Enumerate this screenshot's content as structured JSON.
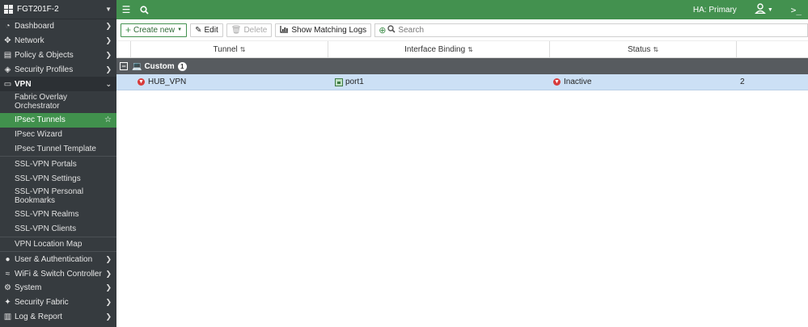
{
  "sidebar": {
    "device_name": "FGT201F-2",
    "items": [
      {
        "label": "Dashboard",
        "icon": "dashboard-icon"
      },
      {
        "label": "Network",
        "icon": "network-icon"
      },
      {
        "label": "Policy & Objects",
        "icon": "policy-icon"
      },
      {
        "label": "Security Profiles",
        "icon": "security-profiles-icon"
      },
      {
        "label": "VPN",
        "icon": "vpn-icon"
      }
    ],
    "vpn_sub": [
      {
        "label": "Fabric Overlay Orchestrator"
      },
      {
        "label": "IPsec Tunnels"
      },
      {
        "label": "IPsec Wizard"
      },
      {
        "label": "IPsec Tunnel Template"
      },
      {
        "label": "SSL-VPN Portals"
      },
      {
        "label": "SSL-VPN Settings"
      },
      {
        "label": "SSL-VPN Personal Bookmarks"
      },
      {
        "label": "SSL-VPN Realms"
      },
      {
        "label": "SSL-VPN Clients"
      },
      {
        "label": "VPN Location Map"
      }
    ],
    "items_after": [
      {
        "label": "User & Authentication",
        "icon": "user-icon"
      },
      {
        "label": "WiFi & Switch Controller",
        "icon": "wifi-icon"
      },
      {
        "label": "System",
        "icon": "gear-icon"
      },
      {
        "label": "Security Fabric",
        "icon": "fabric-icon"
      },
      {
        "label": "Log & Report",
        "icon": "report-icon"
      }
    ]
  },
  "topbar": {
    "ha_status": "HA: Primary"
  },
  "toolbar": {
    "create_new": "Create new",
    "edit": "Edit",
    "delete": "Delete",
    "show_logs": "Show Matching Logs",
    "search_placeholder": "Search"
  },
  "table": {
    "columns": [
      "Tunnel",
      "Interface Binding",
      "Status",
      ""
    ],
    "group": {
      "label": "Custom",
      "count": "1"
    },
    "rows": [
      {
        "tunnel": "HUB_VPN",
        "interface": "port1",
        "status": "Inactive",
        "extra": "2"
      }
    ]
  },
  "colors": {
    "accent_green": "#43914f",
    "sidebar_bg": "#363b3f",
    "selected_row": "#cce0f5",
    "status_down": "#d83b3b"
  }
}
